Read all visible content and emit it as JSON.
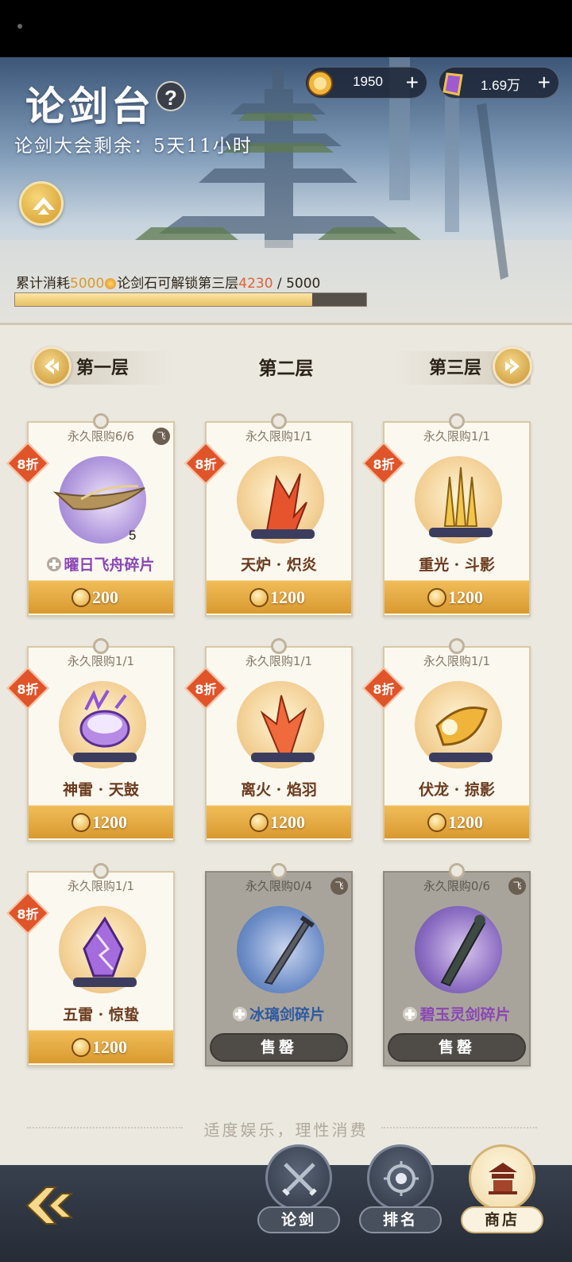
{
  "header": {
    "title": "论剑台",
    "help_symbol": "?",
    "countdown": "论剑大会剩余：5天11小时"
  },
  "currencies": [
    {
      "icon": "gold-coin-icon",
      "value": "1950",
      "plus": "+"
    },
    {
      "icon": "purple-gem-icon",
      "value": "1.69万",
      "plus": "+"
    }
  ],
  "unlock_progress": {
    "prefix": "累计消耗",
    "required": "5000",
    "suffix": "论剑石可解锁第三层",
    "current": "4230",
    "separator": " / ",
    "total": "5000",
    "fraction": 0.846
  },
  "layer_tabs": {
    "prev": "第一层",
    "current": "第二层",
    "next": "第三层"
  },
  "items": [
    {
      "limit": "永久限购6/6",
      "badge": "8折",
      "fly": "飞",
      "name": "曜日飞舟碎片",
      "qty": "5",
      "price": "200",
      "sold_out": false
    },
    {
      "limit": "永久限购1/1",
      "badge": "8折",
      "name": "天炉 · 炽炎",
      "price": "1200",
      "sold_out": false
    },
    {
      "limit": "永久限购1/1",
      "badge": "8折",
      "name": "重光 · 斗影",
      "price": "1200",
      "sold_out": false
    },
    {
      "limit": "永久限购1/1",
      "badge": "8折",
      "name": "神雷 · 天鼓",
      "price": "1200",
      "sold_out": false
    },
    {
      "limit": "永久限购1/1",
      "badge": "8折",
      "name": "离火 · 焰羽",
      "price": "1200",
      "sold_out": false
    },
    {
      "limit": "永久限购1/1",
      "badge": "8折",
      "name": "伏龙 · 掠影",
      "price": "1200",
      "sold_out": false
    },
    {
      "limit": "永久限购1/1",
      "badge": "8折",
      "name": "五雷 · 惊蛰",
      "price": "1200",
      "sold_out": false
    },
    {
      "limit": "永久限购0/4",
      "fly": "飞",
      "name": "冰璃剑碎片",
      "sold_label": "售罄",
      "sold_out": true
    },
    {
      "limit": "永久限购0/6",
      "fly": "飞",
      "name": "碧玉灵剑碎片",
      "sold_label": "售罄",
      "sold_out": true
    }
  ],
  "footer_note": "适度娱乐，理性消费",
  "bottom_nav": [
    {
      "label": "论剑",
      "icon": "crossed-swords-icon",
      "active": false
    },
    {
      "label": "排名",
      "icon": "ranking-emblem-icon",
      "active": false
    },
    {
      "label": "商店",
      "icon": "shop-pavilion-icon",
      "active": true
    }
  ],
  "colors": {
    "accent_gold": "#d99a30",
    "discount_red": "#e0542a",
    "progress_current": "#e0603a"
  }
}
